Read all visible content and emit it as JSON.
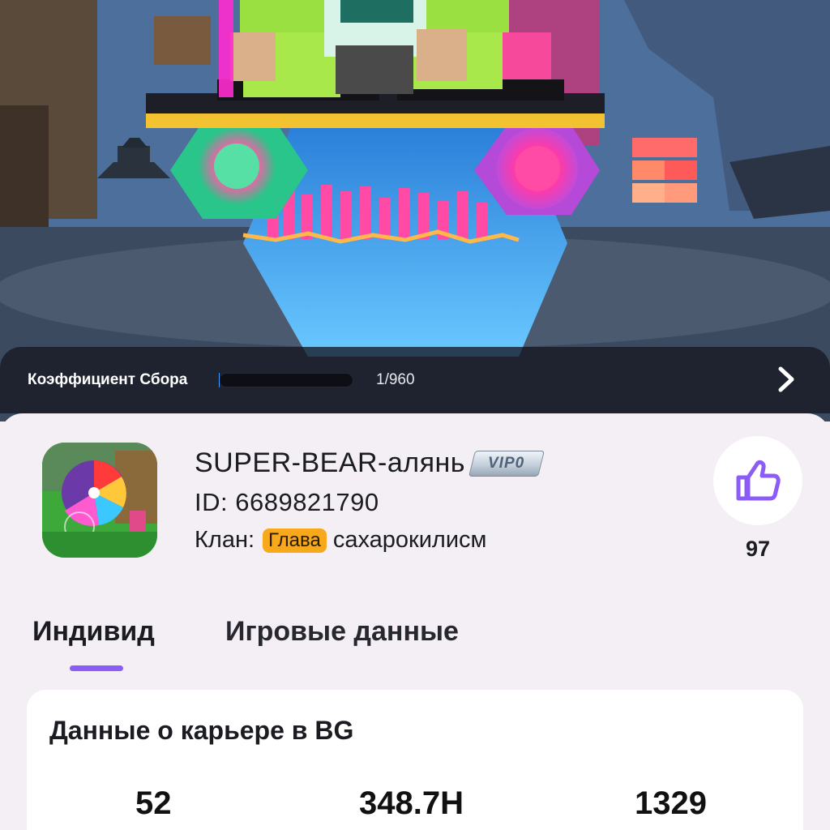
{
  "hero": {
    "collect_label": "Коэффициент Сбора",
    "progress_text": "1/960",
    "progress_fraction": 0.001,
    "next_icon": "chevron-right-icon"
  },
  "profile": {
    "nickname": "SUPER-BEAR-алянь",
    "vip": "VIP0",
    "id_text": "ID: 6689821790",
    "clan_prefix": "Клан:",
    "clan_role": "Глава",
    "clan_name": "сахарокилисм",
    "like_icon": "thumbs-up-icon",
    "like_count": "97"
  },
  "tabs": [
    {
      "label": "Индивид",
      "active": true
    },
    {
      "label": "Игровые данные",
      "active": false
    }
  ],
  "career": {
    "title": "Данные о карьере в BG",
    "stats": [
      "52",
      "348.7H",
      "1329"
    ]
  },
  "colors": {
    "accent": "#8b5cf6",
    "clan_badge": "#f7a81b",
    "panel_bg": "#f4eff5"
  }
}
